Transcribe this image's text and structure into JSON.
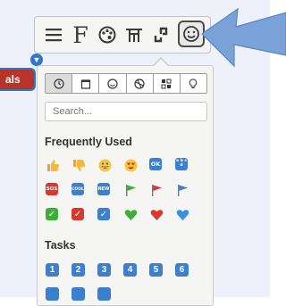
{
  "toolbar": {
    "font_label": "F",
    "buttons": [
      "menu-icon",
      "font-icon",
      "palette-icon",
      "table-icon",
      "link-icon",
      "emoji-icon"
    ]
  },
  "left_tag": {
    "label": "als",
    "pin": "▼"
  },
  "picker": {
    "category_tabs": [
      "clock-icon",
      "calendar-icon",
      "smiley-icon",
      "ball-icon",
      "grid-icon",
      "bulb-icon"
    ],
    "search_placeholder": "Search...",
    "sections": {
      "frequently_used": "Frequently Used",
      "tasks": "Tasks"
    },
    "frequent_badges": {
      "sos": "SOS",
      "cool": "COOL",
      "new": "NEW",
      "ok": "OK",
      "ab": "a b c d"
    },
    "task_numbers": [
      "1",
      "2",
      "3",
      "4",
      "5",
      "6"
    ]
  },
  "colors": {
    "accent": "#2f75c8",
    "tag_red": "#b7342b",
    "arrow_blue": "#7aa2d8"
  }
}
